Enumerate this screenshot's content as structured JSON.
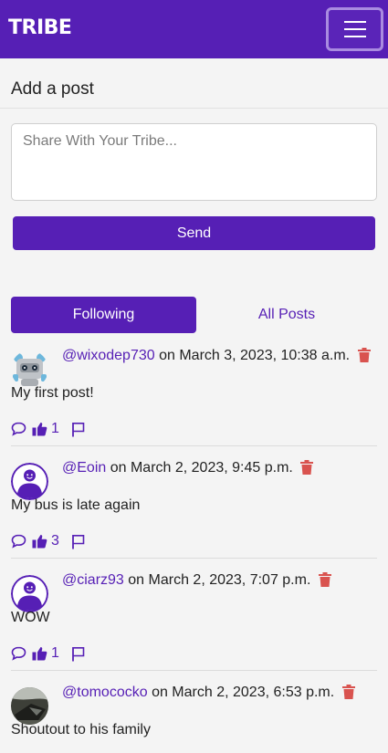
{
  "navbar": {
    "brand": "TRIBE",
    "menu_icon": "hamburger-icon"
  },
  "add_post": {
    "title": "Add a post",
    "placeholder": "Share With Your Tribe...",
    "send_label": "Send"
  },
  "tabs": {
    "following": "Following",
    "all_posts": "All Posts"
  },
  "colors": {
    "brand": "#561fb5",
    "delete": "#d9534f",
    "background": "#f4f4f4"
  },
  "posts": [
    {
      "username": "@wixodep730",
      "date": "on March 3, 2023, 10:38 a.m.",
      "content": "My first post!",
      "likes": "1",
      "avatar": "robot-avatar"
    },
    {
      "username": "@Eoin",
      "date": "on March 2, 2023, 9:45 p.m.",
      "content": "My bus is late again",
      "likes": "3",
      "avatar": "default-user-avatar"
    },
    {
      "username": "@ciarz93",
      "date": "on March 2, 2023, 7:07 p.m.",
      "content": "WOW",
      "likes": "1",
      "avatar": "default-user-avatar"
    },
    {
      "username": "@tomococko",
      "date": "on March 2, 2023, 6:53 p.m.",
      "content": "Shoutout to his family",
      "likes": "",
      "avatar": "photo-avatar"
    }
  ]
}
